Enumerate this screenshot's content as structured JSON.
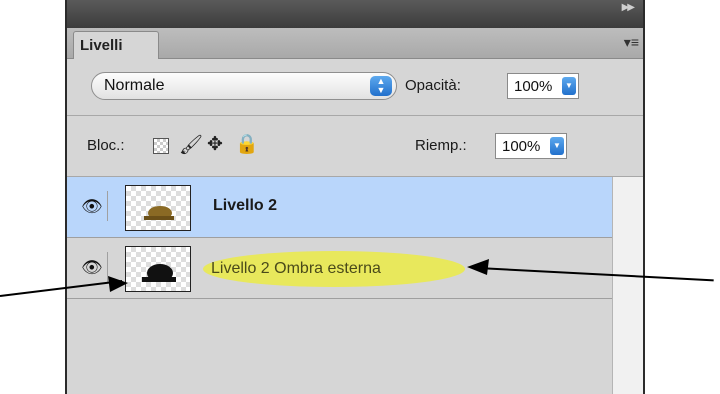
{
  "panel": {
    "tab_title": "Livelli",
    "blend_mode": "Normale",
    "opacity_label": "Opacità:",
    "opacity_value": "100%",
    "lock_label": "Bloc.:",
    "fill_label": "Riemp.:",
    "fill_value": "100%"
  },
  "layers": [
    {
      "name": "Livello 2",
      "selected": true,
      "visible": true
    },
    {
      "name": "Livello 2 Ombra esterna",
      "selected": false,
      "visible": true
    }
  ],
  "colors": {
    "selected_row": "#b9d6fb",
    "highlight": "#e8e85c",
    "accent": "#2170cc"
  }
}
